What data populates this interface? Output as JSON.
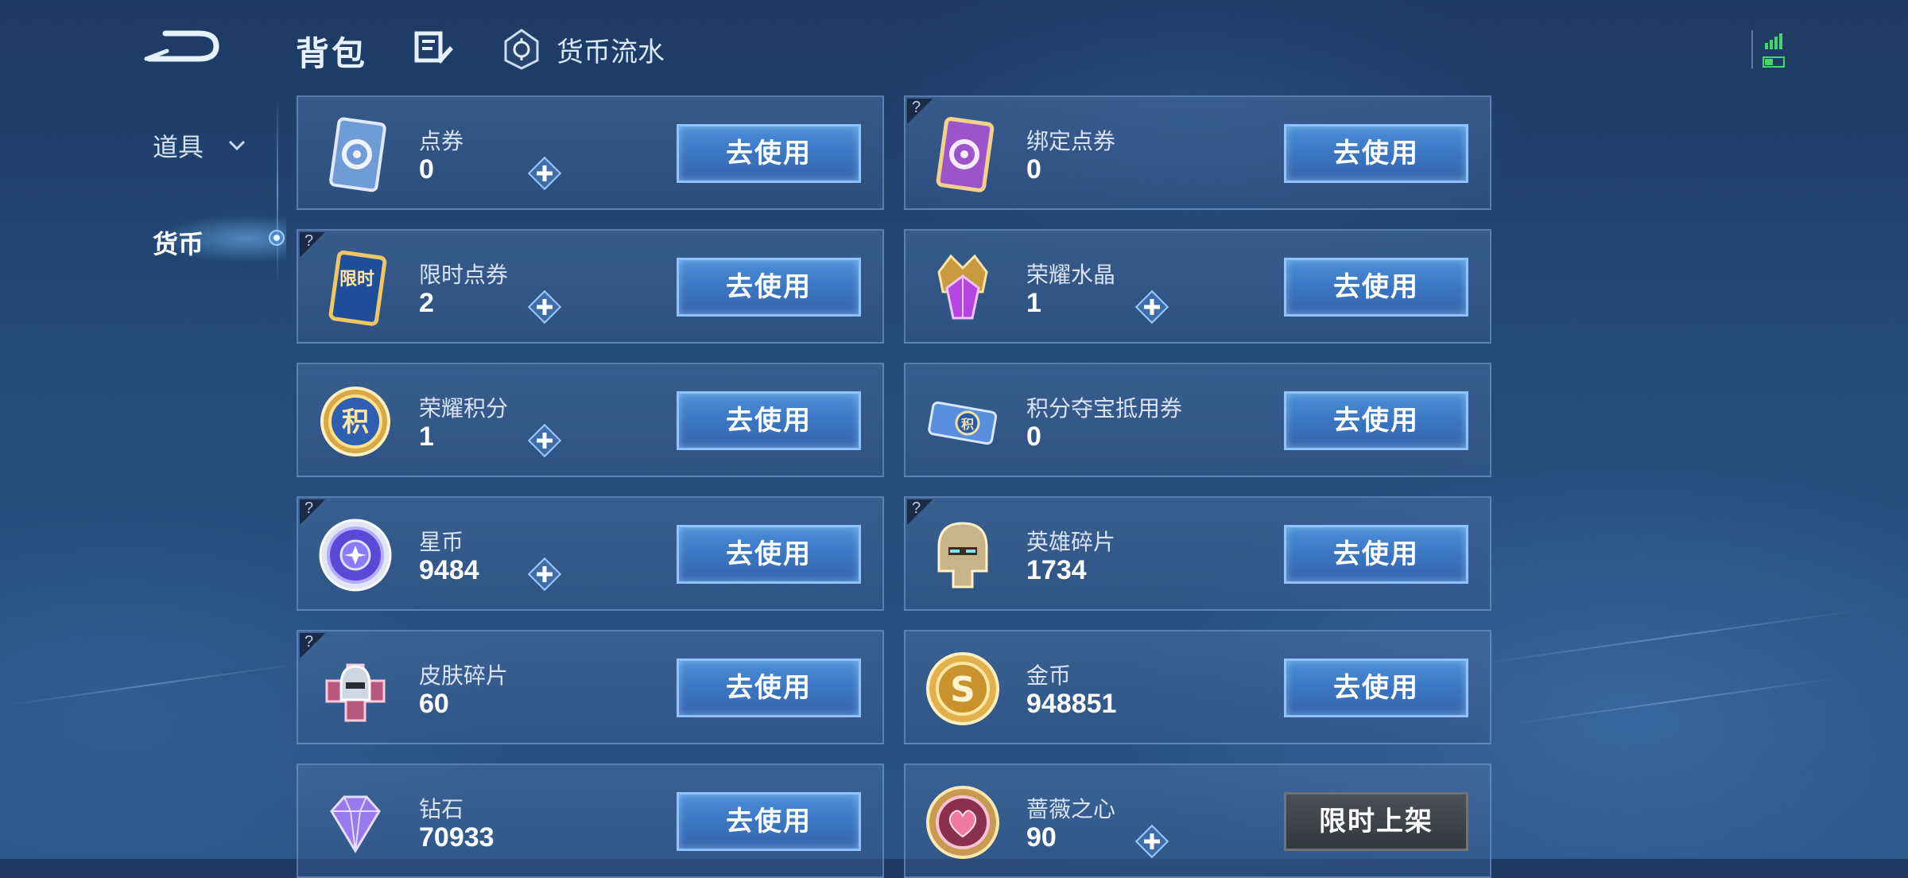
{
  "header": {
    "title": "背包",
    "flow_label": "货币流水"
  },
  "sidebar": {
    "items": [
      {
        "label": "道具"
      },
      {
        "label": "货币"
      }
    ]
  },
  "cards": [
    {
      "name": "点券",
      "value": "0",
      "button": "去使用"
    },
    {
      "name": "绑定点券",
      "value": "0",
      "button": "去使用"
    },
    {
      "name": "限时点券",
      "value": "2",
      "button": "去使用"
    },
    {
      "name": "荣耀水晶",
      "value": "1",
      "button": "去使用"
    },
    {
      "name": "荣耀积分",
      "value": "1",
      "button": "去使用"
    },
    {
      "name": "积分夺宝抵用券",
      "value": "0",
      "button": "去使用"
    },
    {
      "name": "星币",
      "value": "9484",
      "button": "去使用"
    },
    {
      "name": "英雄碎片",
      "value": "1734",
      "button": "去使用"
    },
    {
      "name": "皮肤碎片",
      "value": "60",
      "button": "去使用"
    },
    {
      "name": "金币",
      "value": "948851",
      "button": "去使用"
    },
    {
      "name": "钻石",
      "value": "70933",
      "button": "去使用"
    },
    {
      "name": "蔷薇之心",
      "value": "90",
      "button": "限时上架"
    }
  ],
  "icon_texts": {
    "limited": "限时",
    "points": "积",
    "gold": "S"
  },
  "colors": {
    "accent": "#8fc3ff",
    "button": "#3a74c0",
    "background": "#244a78"
  }
}
